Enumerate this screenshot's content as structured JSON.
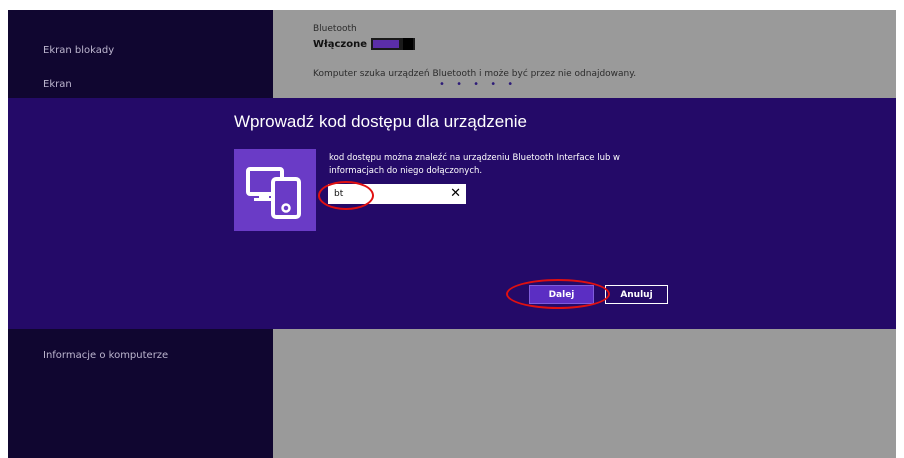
{
  "left_nav": {
    "items": [
      "Ekran blokady",
      "Ekran",
      "Informacje o komputerze"
    ]
  },
  "bluetooth": {
    "label": "Bluetooth",
    "state": "Włączone",
    "status": "Komputer szuka urządzeń Bluetooth i może być przez nie odnajdowany.",
    "progress_dots": "• • • • •"
  },
  "dialog": {
    "title": "Wprowadź kod dostępu dla urządzenie",
    "instruction": "kod dostępu można znaleźć na urządzeniu Bluetooth Interface lub w informacjach do niego dołączonych.",
    "passcode_value": "bt",
    "clear_glyph": "✕",
    "next_label": "Dalej",
    "cancel_label": "Anuluj",
    "icon": "devices-icon"
  },
  "colors": {
    "dialog_bg": "#240a68",
    "tile_bg": "#6a3bc6",
    "left_pane_bg": "#100630",
    "annotation": "#e01010"
  }
}
